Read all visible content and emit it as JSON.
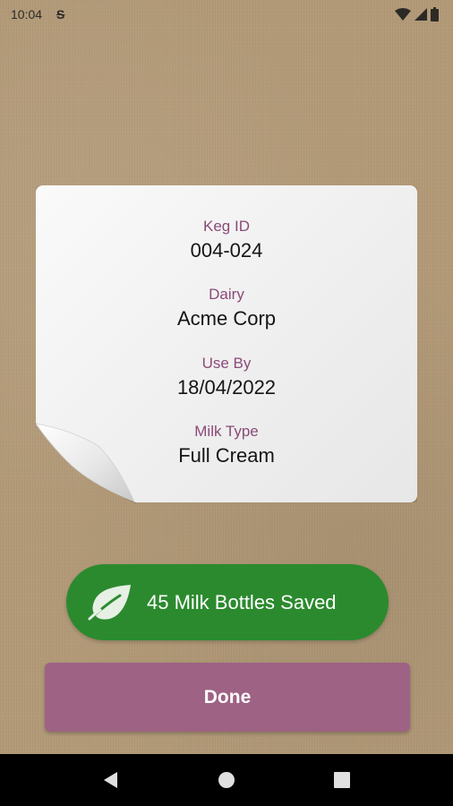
{
  "status_bar": {
    "time": "10:04",
    "notification_glyph": "S",
    "icons": [
      "wifi-icon",
      "cellular-icon",
      "battery-icon"
    ]
  },
  "label": {
    "fields": [
      {
        "label": "Keg ID",
        "value": "004-024"
      },
      {
        "label": "Dairy",
        "value": "Acme Corp"
      },
      {
        "label": "Use By",
        "value": "18/04/2022"
      },
      {
        "label": "Milk Type",
        "value": "Full Cream"
      }
    ]
  },
  "bottles": {
    "icon": "leaf-icon",
    "text": "45 Milk Bottles Saved"
  },
  "done_label": "Done",
  "nav": {
    "icons": [
      "back-icon",
      "home-icon",
      "recents-icon"
    ]
  },
  "colors": {
    "background": "#b29a78",
    "label_text": "#8a4a78",
    "green": "#2b8a2e",
    "button": "#9e6284"
  }
}
